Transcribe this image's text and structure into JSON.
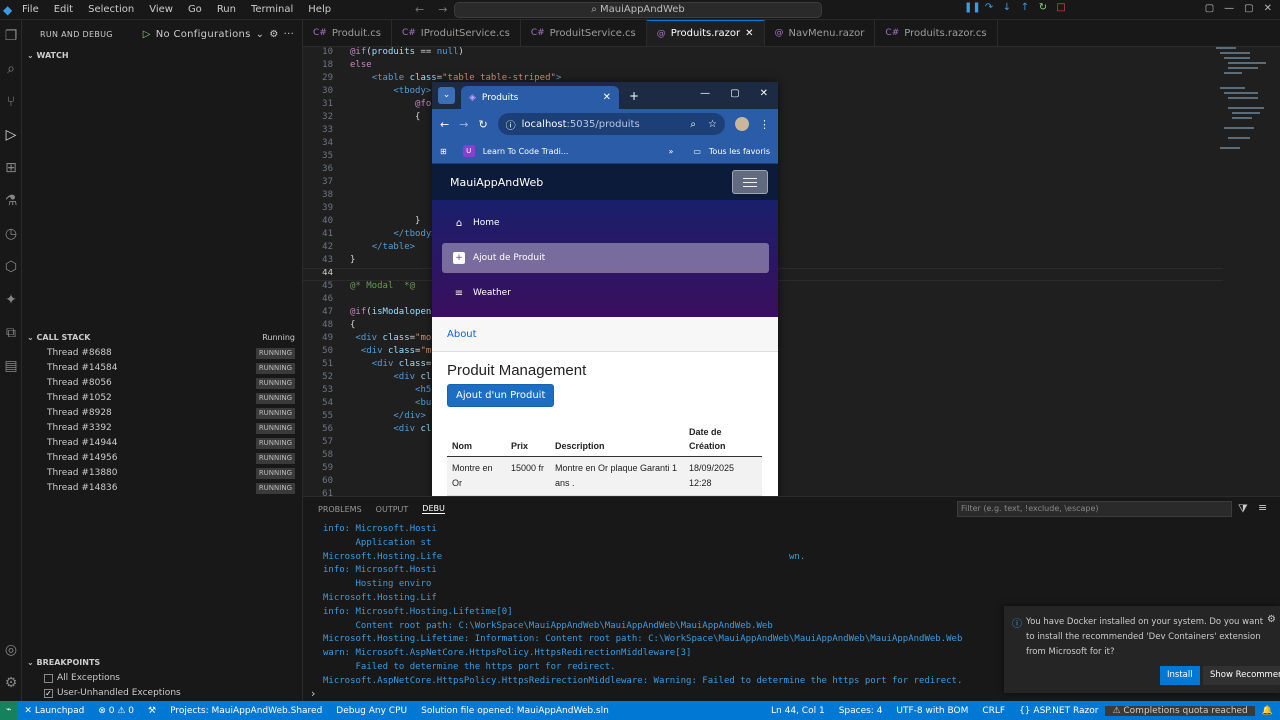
{
  "window": {
    "menu": [
      "File",
      "Edit",
      "Selection",
      "View",
      "Go",
      "Run",
      "Terminal",
      "Help"
    ],
    "search": "MauiAppAndWeb"
  },
  "sidebar": {
    "header": "RUN AND DEBUG",
    "config": "No Configurations",
    "watch": "WATCH",
    "callstack": "CALL STACK",
    "callstack_state": "Running",
    "threads": [
      {
        "name": "Thread #8688",
        "state": "RUNNING"
      },
      {
        "name": "Thread #14584",
        "state": "RUNNING"
      },
      {
        "name": "Thread #8056",
        "state": "RUNNING"
      },
      {
        "name": "Thread #1052",
        "state": "RUNNING"
      },
      {
        "name": "Thread #8928",
        "state": "RUNNING"
      },
      {
        "name": "Thread #3392",
        "state": "RUNNING"
      },
      {
        "name": "Thread #14944",
        "state": "RUNNING"
      },
      {
        "name": "Thread #14956",
        "state": "RUNNING"
      },
      {
        "name": "Thread #13880",
        "state": "RUNNING"
      },
      {
        "name": "Thread #14836",
        "state": "RUNNING"
      }
    ],
    "breakpoints": "BREAKPOINTS",
    "bp_items": [
      "All Exceptions",
      "User-Unhandled Exceptions"
    ]
  },
  "tabs": [
    "Produit.cs",
    "IProduitService.cs",
    "ProduitService.cs",
    "Produits.razor",
    "NavMenu.razor",
    "Produits.razor.cs"
  ],
  "editor": {
    "lines": [
      "10",
      "18",
      "29",
      "30",
      "31",
      "32",
      "33",
      "34",
      "35",
      "36",
      "37",
      "38",
      "39",
      "40",
      "41",
      "42",
      "43",
      "44",
      "45",
      "46",
      "47",
      "48",
      "49",
      "50",
      "51",
      "52",
      "53",
      "54",
      "55",
      "56",
      "57",
      "58",
      "59",
      "60",
      "61"
    ]
  },
  "panel": {
    "tabs": [
      "PROBLEMS",
      "OUTPUT",
      "DEBU"
    ],
    "filter": "Filter (e.g. text, !exclude, \\escape)",
    "output": "info: Microsoft.Hosti\n      Application st\nMicrosoft.Hosting.Life                                                                wn.\ninfo: Microsoft.Hosti\n      Hosting enviro\nMicrosoft.Hosting.Lif\ninfo: Microsoft.Hosting.Lifetime[0]\n      Content root path: C:\\WorkSpace\\MauiAppAndWeb\\MauiAppAndWeb\\MauiAppAndWeb.Web\nMicrosoft.Hosting.Lifetime: Information: Content root path: C:\\WorkSpace\\MauiAppAndWeb\\MauiAppAndWeb\\MauiAppAndWeb.Web\nwarn: Microsoft.AspNetCore.HttpsPolicy.HttpsRedirectionMiddleware[3]\n      Failed to determine the https port for redirect.\nMicrosoft.AspNetCore.HttpsPolicy.HttpsRedirectionMiddleware: Warning: Failed to determine the https port for redirect."
  },
  "browser": {
    "tab_title": "Produits",
    "url_host": "localhost",
    "url_rest": ":5035/produits",
    "bookmark": "Learn To Code Tradi...",
    "all_favs": "Tous les favoris",
    "app_title": "MauiAppAndWeb",
    "nav": [
      {
        "label": "Home",
        "icon": "home-icon"
      },
      {
        "label": "Ajout de Produit",
        "icon": "plus-icon"
      },
      {
        "label": "Weather",
        "icon": "list-icon"
      }
    ],
    "about": "About",
    "heading": "Produit Management",
    "add_button": "Ajout d'un Produit",
    "table": {
      "headers": [
        "Nom",
        "Prix",
        "Description",
        "Date de Création"
      ],
      "rows": [
        [
          "Montre en Or",
          "15000 fr",
          "Montre en Or plaque Garanti 1 ans .",
          "18/09/2025 12:28"
        ]
      ]
    }
  },
  "toast": {
    "message": "You have Docker installed on your system. Do you want to install the recommended 'Dev Containers' extension from Microsoft for it?",
    "install": "Install",
    "show": "Show Recommendations"
  },
  "status": {
    "launchpad": "Launchpad",
    "errors": "0",
    "warnings": "0",
    "project": "Projects: MauiAppAndWeb.Shared",
    "config": "Debug Any CPU",
    "solution": "Solution file opened: MauiAppAndWeb.sln",
    "position": "Ln 44, Col 1",
    "spaces": "Spaces: 4",
    "encoding": "UTF-8 with BOM",
    "eol": "CRLF",
    "language": "ASP.NET Razor",
    "quota": "Completions quota reached"
  }
}
